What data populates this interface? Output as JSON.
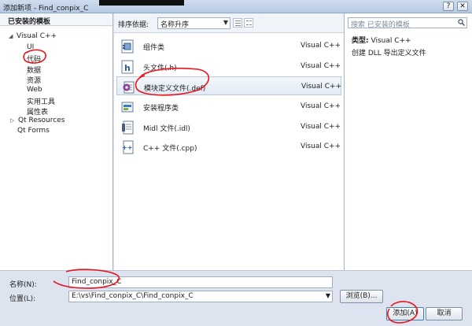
{
  "window": {
    "title": "添加新项 - Find_conpix_C",
    "help_label": "?",
    "close_label": "✕"
  },
  "left": {
    "header": "已安装的模板",
    "tree": {
      "root": "Visual C++",
      "children": [
        "UI",
        "代码",
        "数据",
        "资源",
        "Web",
        "实用工具",
        "属性表"
      ],
      "siblings": [
        "Qt Resources",
        "Qt Forms"
      ]
    }
  },
  "toolbar": {
    "sort_label": "排序依据:",
    "sort_value": "名称升序"
  },
  "templates": [
    {
      "name": "组件类",
      "lang": "Visual C++",
      "icon": "component-class-icon"
    },
    {
      "name": "头文件(.h)",
      "lang": "Visual C++",
      "icon": "header-file-icon"
    },
    {
      "name": "模块定义文件(.def)",
      "lang": "Visual C++",
      "icon": "module-definition-icon",
      "selected": true
    },
    {
      "name": "安装程序类",
      "lang": "Visual C++",
      "icon": "installer-class-icon"
    },
    {
      "name": "Midl 文件(.idl)",
      "lang": "Visual C++",
      "icon": "midl-file-icon"
    },
    {
      "name": "C++ 文件(.cpp)",
      "lang": "Visual C++",
      "icon": "cpp-file-icon"
    }
  ],
  "details": {
    "search_placeholder": "搜索 已安装的模板",
    "type_label": "类型:",
    "type_value": "Visual C++",
    "description": "创建 DLL 导出定义文件"
  },
  "form": {
    "name_label": "名称(N):",
    "name_value": "Find_conpix_C",
    "location_label": "位置(L):",
    "location_value": "E:\\vs\\Find_conpix_C\\Find_conpix_C",
    "browse_label": "浏览(B)...",
    "add_label": "添加(A)",
    "cancel_label": "取消"
  },
  "colors": {
    "annotation_red": "#e8141c",
    "selection_border": "#b7c8df",
    "frame_blue": "#5a6c86"
  }
}
